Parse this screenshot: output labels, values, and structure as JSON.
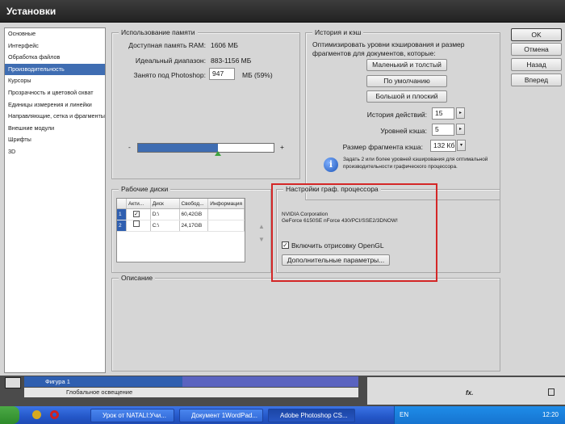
{
  "window": {
    "title": "Установки"
  },
  "nav": {
    "items": [
      {
        "label": "Основные",
        "selected": false
      },
      {
        "label": "Интерфейс",
        "selected": false
      },
      {
        "label": "Обработка файлов",
        "selected": false
      },
      {
        "label": "Производительность",
        "selected": true
      },
      {
        "label": "Курсоры",
        "selected": false
      },
      {
        "label": "Прозрачность и цветовой охват",
        "selected": false
      },
      {
        "label": "Единицы измерения и линейки",
        "selected": false
      },
      {
        "label": "Направляющие, сетка и фрагменты",
        "selected": false
      },
      {
        "label": "Внешние модули",
        "selected": false
      },
      {
        "label": "Шрифты",
        "selected": false
      },
      {
        "label": "3D",
        "selected": false
      }
    ]
  },
  "memory": {
    "title": "Использование памяти",
    "ram_label": "Доступная память RAM:",
    "ram_value": "1606 МБ",
    "range_label": "Идеальный диапазон:",
    "range_value": "883-1156 МБ",
    "used_label": "Занято под Photoshop:",
    "used_value": "947",
    "used_unit": "МБ (59%)",
    "used_fraction": 0.59,
    "minus": "-",
    "plus": "+"
  },
  "history": {
    "title": "История и кэш",
    "desc": "Оптимизировать уровни кэширования и размер фрагментов для документов, которые:",
    "btn_tall": "Маленький и толстый",
    "btn_default": "По умолчанию",
    "btn_wide": "Большой и плоский",
    "states_label": "История действий:",
    "states_value": "15",
    "cache_label": "Уровней кэша:",
    "cache_value": "5",
    "tile_label": "Размер фрагмента кэша:",
    "tile_value": "132 Кб",
    "info": "Задать 2 или более уровней кэширования для оптимальной производительности графического процессора."
  },
  "disks": {
    "title": "Рабочие диски",
    "columns": [
      "",
      "Акти...",
      "Диск",
      "Свобод...",
      "Информация"
    ],
    "rows": [
      {
        "num": "1",
        "active": true,
        "drive": "D:\\",
        "free": "60,42GB",
        "info": ""
      },
      {
        "num": "2",
        "active": false,
        "drive": "C:\\",
        "free": "24,17GB",
        "info": ""
      }
    ],
    "up": "▲",
    "down": "▼"
  },
  "gpu": {
    "title": "Настройки граф. процессора",
    "vendor": "NVIDIA Corporation",
    "model": "GeForce 6150SE nForce 430/PCI/SSE2/3DNOW!",
    "opengl_label": "Включить отрисовку OpenGL",
    "opengl_checked": true,
    "advanced_button": "Дополнительные параметры..."
  },
  "description": {
    "title": "Описание"
  },
  "buttons": {
    "ok": "OK",
    "cancel": "Отмена",
    "prev": "Назад",
    "next": "Вперед"
  },
  "layers": {
    "layer_name": "Фигура 1",
    "effect_name": "Глобальное освещение",
    "fx": "fx."
  },
  "taskbar": {
    "tasks": [
      "Урок от NATALI:Учи...",
      "Документ 1WordPad...",
      "Adobe Photoshop CS..."
    ],
    "lang": "EN",
    "clock": "12:20"
  },
  "colors": {
    "accent": "#3f6db2",
    "highlight": "#d42727",
    "taskbar": "#2457c8"
  }
}
